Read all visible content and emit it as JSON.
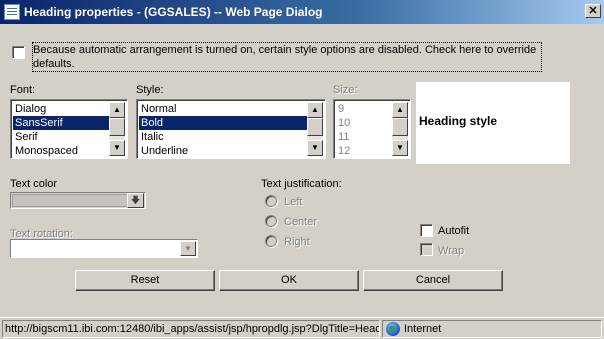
{
  "window": {
    "title": "Heading properties - (GGSALES) -- Web Page Dialog",
    "close_glyph": "✕"
  },
  "override": {
    "checked": false,
    "text": "Because automatic arrangement is turned on, certain style options are disabled. Check here to override defaults."
  },
  "font": {
    "label": "Font:",
    "items": [
      "Dialog",
      "SansSerif",
      "Serif",
      "Monospaced"
    ],
    "selected": "SansSerif"
  },
  "style": {
    "label": "Style:",
    "items": [
      "Normal",
      "Bold",
      "Italic",
      "Underline"
    ],
    "selected": "Bold"
  },
  "size": {
    "label": "Size:",
    "items": [
      "9",
      "10",
      "11",
      "12"
    ],
    "disabled": true
  },
  "preview": {
    "text": "Heading style"
  },
  "text_color": {
    "label": "Text color",
    "dropdown_glyph": "🡇"
  },
  "text_rotation": {
    "label": "Text rotation:",
    "value": "",
    "disabled": true
  },
  "justification": {
    "label": "Text justification:",
    "options": [
      "Left",
      "Center",
      "Right"
    ],
    "disabled": true
  },
  "autofit": {
    "label": "Autofit",
    "checked": false
  },
  "wrap": {
    "label": "Wrap",
    "checked": false,
    "disabled": true
  },
  "buttons": {
    "reset": "Reset",
    "ok": "OK",
    "cancel": "Cancel"
  },
  "statusbar": {
    "url": "http://bigscm11.ibi.com:12480/ibi_apps/assist/jsp/hpropdlg.jsp?DlgTitle=Head",
    "zone": "Internet"
  },
  "colors": {
    "titlebar_start": "#0a246a",
    "titlebar_end": "#a6caf0",
    "selection": "#0a246a",
    "face": "#d4d0c8"
  }
}
